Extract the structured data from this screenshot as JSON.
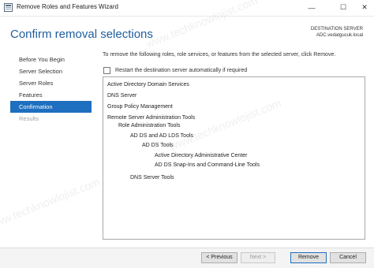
{
  "window": {
    "title": "Remove Roles and Features Wizard",
    "minimize_glyph": "—",
    "maximize_glyph": "☐",
    "close_glyph": "✕"
  },
  "header": {
    "heading": "Confirm removal selections",
    "destination_label": "DESTINATION SERVER",
    "destination_server": "ADC.vedatgucuk.local"
  },
  "nav": {
    "items": [
      {
        "label": "Before You Begin",
        "active": false
      },
      {
        "label": "Server Selection",
        "active": false
      },
      {
        "label": "Server Roles",
        "active": false
      },
      {
        "label": "Features",
        "active": false
      },
      {
        "label": "Confirmation",
        "active": true
      },
      {
        "label": "Results",
        "active": false
      }
    ]
  },
  "content": {
    "instruction": "To remove the following roles, role services, or features from the selected server, click Remove.",
    "restart_label": "Restart the destination server automatically if required",
    "restart_checked": false,
    "items": [
      {
        "label": "Active Directory Domain Services",
        "level": 0
      },
      {
        "label": "DNS Server",
        "level": 0
      },
      {
        "label": "Group Policy Management",
        "level": 0
      },
      {
        "label": "Remote Server Administration Tools",
        "level": 0
      },
      {
        "label": "Role Administration Tools",
        "level": 1
      },
      {
        "label": "AD DS and AD LDS Tools",
        "level": 2
      },
      {
        "label": "AD DS Tools",
        "level": 3
      },
      {
        "label": "Active Directory Administrative Center",
        "level": 4
      },
      {
        "label": "AD DS Snap-Ins and Command-Line Tools",
        "level": 4
      },
      {
        "label": "DNS Server Tools",
        "level": 2
      }
    ]
  },
  "footer": {
    "previous_label": "< Previous",
    "next_label": "Next >",
    "remove_label": "Remove",
    "cancel_label": "Cancel"
  },
  "watermark_text": "www.techknowlojist.com",
  "colors": {
    "accent": "#1e6fbf",
    "heading": "#1f5e9e"
  }
}
